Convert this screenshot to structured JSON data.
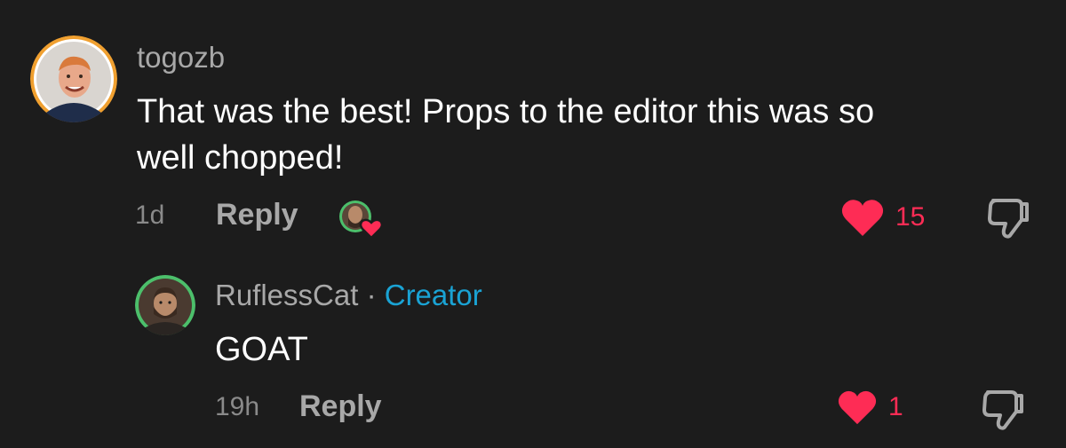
{
  "comment": {
    "username": "togozb",
    "text_line1": "That was the best! Props to the editor this was so",
    "text_line2": "well chopped!",
    "time": "1d",
    "reply_label": "Reply",
    "likes": "15",
    "liked_by_creator": true
  },
  "reply": {
    "username": "RuflessCat",
    "separator": "·",
    "badge": "Creator",
    "text": "GOAT",
    "time": "19h",
    "reply_label": "Reply",
    "likes": "1"
  },
  "colors": {
    "background": "#1c1c1c",
    "like_red": "#fe2c55",
    "creator_blue": "#1aa3d4",
    "avatar_ring_orange": "#f0a030",
    "avatar_ring_green": "#4cbf6b"
  },
  "icons": {
    "heart": "heart-icon",
    "dislike": "thumbs-down-icon"
  }
}
